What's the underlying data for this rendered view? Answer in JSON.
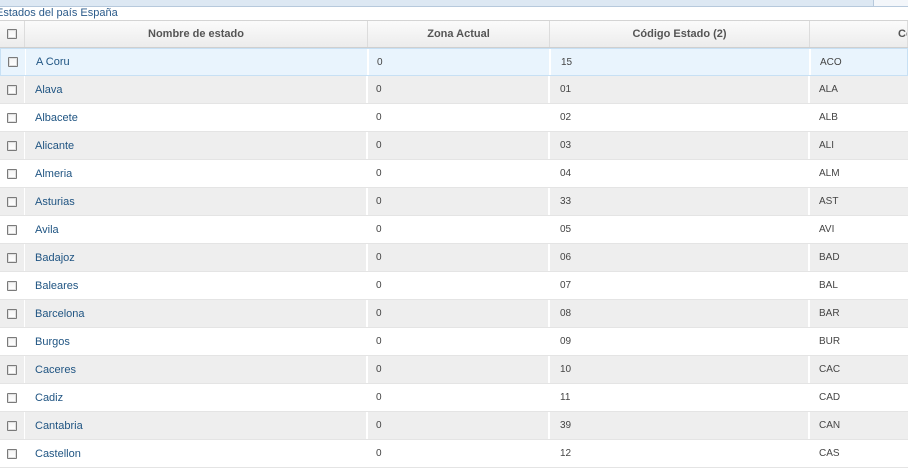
{
  "breadcrumb": "Estados del país España",
  "columns": [
    "Nombre de estado",
    "Zona Actual",
    "Código Estado (2)",
    "Có"
  ],
  "rows": [
    {
      "name": "A Coru",
      "zone": "0",
      "code2": "15",
      "code3": "ACO"
    },
    {
      "name": "Alava",
      "zone": "0",
      "code2": "01",
      "code3": "ALA"
    },
    {
      "name": "Albacete",
      "zone": "0",
      "code2": "02",
      "code3": "ALB"
    },
    {
      "name": "Alicante",
      "zone": "0",
      "code2": "03",
      "code3": "ALI"
    },
    {
      "name": "Almeria",
      "zone": "0",
      "code2": "04",
      "code3": "ALM"
    },
    {
      "name": "Asturias",
      "zone": "0",
      "code2": "33",
      "code3": "AST"
    },
    {
      "name": "Avila",
      "zone": "0",
      "code2": "05",
      "code3": "AVI"
    },
    {
      "name": "Badajoz",
      "zone": "0",
      "code2": "06",
      "code3": "BAD"
    },
    {
      "name": "Baleares",
      "zone": "0",
      "code2": "07",
      "code3": "BAL"
    },
    {
      "name": "Barcelona",
      "zone": "0",
      "code2": "08",
      "code3": "BAR"
    },
    {
      "name": "Burgos",
      "zone": "0",
      "code2": "09",
      "code3": "BUR"
    },
    {
      "name": "Caceres",
      "zone": "0",
      "code2": "10",
      "code3": "CAC"
    },
    {
      "name": "Cadiz",
      "zone": "0",
      "code2": "11",
      "code3": "CAD"
    },
    {
      "name": "Cantabria",
      "zone": "0",
      "code2": "39",
      "code3": "CAN"
    },
    {
      "name": "Castellon",
      "zone": "0",
      "code2": "12",
      "code3": "CAS"
    }
  ]
}
